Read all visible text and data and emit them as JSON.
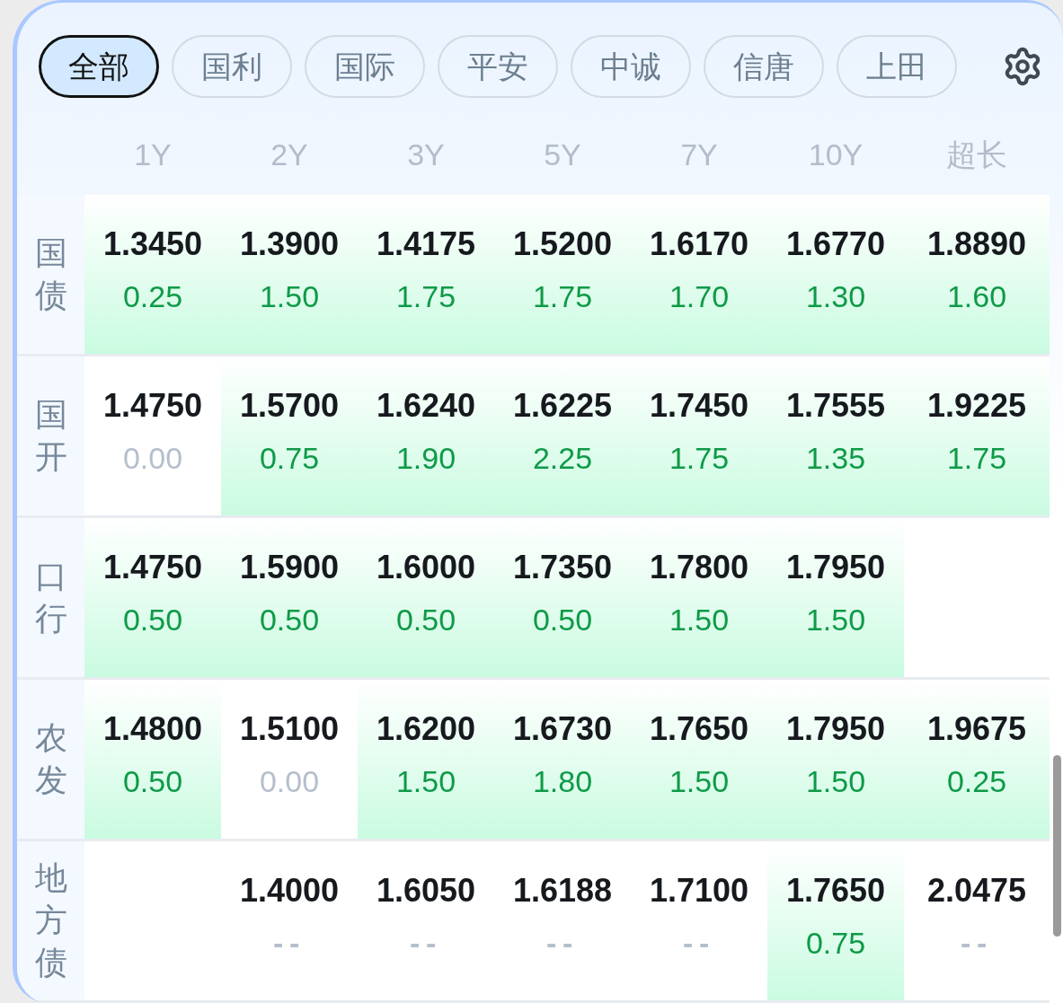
{
  "tabs": [
    {
      "label": "全部",
      "selected": true
    },
    {
      "label": "国利",
      "selected": false
    },
    {
      "label": "国际",
      "selected": false
    },
    {
      "label": "平安",
      "selected": false
    },
    {
      "label": "中诚",
      "selected": false
    },
    {
      "label": "信唐",
      "selected": false
    },
    {
      "label": "上田",
      "selected": false
    }
  ],
  "columns": [
    "1Y",
    "2Y",
    "3Y",
    "5Y",
    "7Y",
    "10Y",
    "超长"
  ],
  "rows": [
    {
      "label": "国债",
      "cells": [
        {
          "kind": "up",
          "rate": "1.3450",
          "change": "0.25"
        },
        {
          "kind": "up",
          "rate": "1.3900",
          "change": "1.50"
        },
        {
          "kind": "up",
          "rate": "1.4175",
          "change": "1.75"
        },
        {
          "kind": "up",
          "rate": "1.5200",
          "change": "1.75"
        },
        {
          "kind": "up",
          "rate": "1.6170",
          "change": "1.70"
        },
        {
          "kind": "up",
          "rate": "1.6770",
          "change": "1.30"
        },
        {
          "kind": "up",
          "rate": "1.8890",
          "change": "1.60"
        }
      ]
    },
    {
      "label": "国开",
      "cells": [
        {
          "kind": "flat",
          "rate": "1.4750",
          "change": "0.00"
        },
        {
          "kind": "up",
          "rate": "1.5700",
          "change": "0.75"
        },
        {
          "kind": "up",
          "rate": "1.6240",
          "change": "1.90"
        },
        {
          "kind": "up",
          "rate": "1.6225",
          "change": "2.25"
        },
        {
          "kind": "up",
          "rate": "1.7450",
          "change": "1.75"
        },
        {
          "kind": "up",
          "rate": "1.7555",
          "change": "1.35"
        },
        {
          "kind": "up",
          "rate": "1.9225",
          "change": "1.75"
        }
      ]
    },
    {
      "label": "口行",
      "cells": [
        {
          "kind": "up",
          "rate": "1.4750",
          "change": "0.50"
        },
        {
          "kind": "up",
          "rate": "1.5900",
          "change": "0.50"
        },
        {
          "kind": "up",
          "rate": "1.6000",
          "change": "0.50"
        },
        {
          "kind": "up",
          "rate": "1.7350",
          "change": "0.50"
        },
        {
          "kind": "up",
          "rate": "1.7800",
          "change": "1.50"
        },
        {
          "kind": "up",
          "rate": "1.7950",
          "change": "1.50"
        },
        {
          "kind": "empty"
        }
      ]
    },
    {
      "label": "农发",
      "cells": [
        {
          "kind": "up",
          "rate": "1.4800",
          "change": "0.50"
        },
        {
          "kind": "flat",
          "rate": "1.5100",
          "change": "0.00"
        },
        {
          "kind": "up",
          "rate": "1.6200",
          "change": "1.50"
        },
        {
          "kind": "up",
          "rate": "1.6730",
          "change": "1.80"
        },
        {
          "kind": "up",
          "rate": "1.7650",
          "change": "1.50"
        },
        {
          "kind": "up",
          "rate": "1.7950",
          "change": "1.50"
        },
        {
          "kind": "up",
          "rate": "1.9675",
          "change": "0.25"
        }
      ]
    },
    {
      "label": "地方债",
      "cells": [
        {
          "kind": "empty"
        },
        {
          "kind": "none",
          "rate": "1.4000",
          "change": "--"
        },
        {
          "kind": "none",
          "rate": "1.6050",
          "change": "--"
        },
        {
          "kind": "none",
          "rate": "1.6188",
          "change": "--"
        },
        {
          "kind": "none",
          "rate": "1.7100",
          "change": "--"
        },
        {
          "kind": "up",
          "rate": "1.7650",
          "change": "0.75"
        },
        {
          "kind": "none",
          "rate": "2.0475",
          "change": "--"
        }
      ]
    }
  ]
}
